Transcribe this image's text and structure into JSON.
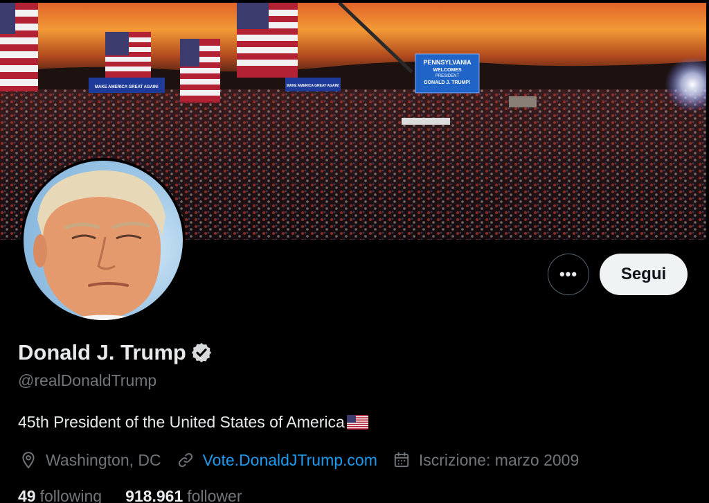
{
  "banner": {
    "signs": [
      "MAKE AMERICA GREAT AGAIN!",
      "MAKE AMERICA GREAT AGAIN!"
    ],
    "screen_lines": [
      "PENNSYLVANIA",
      "WELCOMES",
      "PRESIDENT",
      "DONALD J. TRUMP!"
    ]
  },
  "actions": {
    "more_label": "•••",
    "follow_label": "Segui"
  },
  "profile": {
    "name": "Donald J. Trump",
    "handle": "@realDonaldTrump",
    "bio": "45th President of the United States of America",
    "location": "Washington, DC",
    "website": "Vote.DonaldJTrump.com",
    "joined": "Iscrizione: marzo 2009"
  },
  "stats": {
    "following_count": "49",
    "following_label": "following",
    "follower_count": "918.961",
    "follower_label": "follower"
  },
  "icons": {
    "verified": "verified-badge-icon",
    "bio_emoji": "us-flag-icon",
    "location": "location-pin-icon",
    "website": "link-icon",
    "joined": "calendar-icon"
  },
  "colors": {
    "background": "#000000",
    "text_primary": "#e7e9ea",
    "text_secondary": "#71767b",
    "link": "#1d9bf0",
    "follow_button_bg": "#eff3f4"
  }
}
